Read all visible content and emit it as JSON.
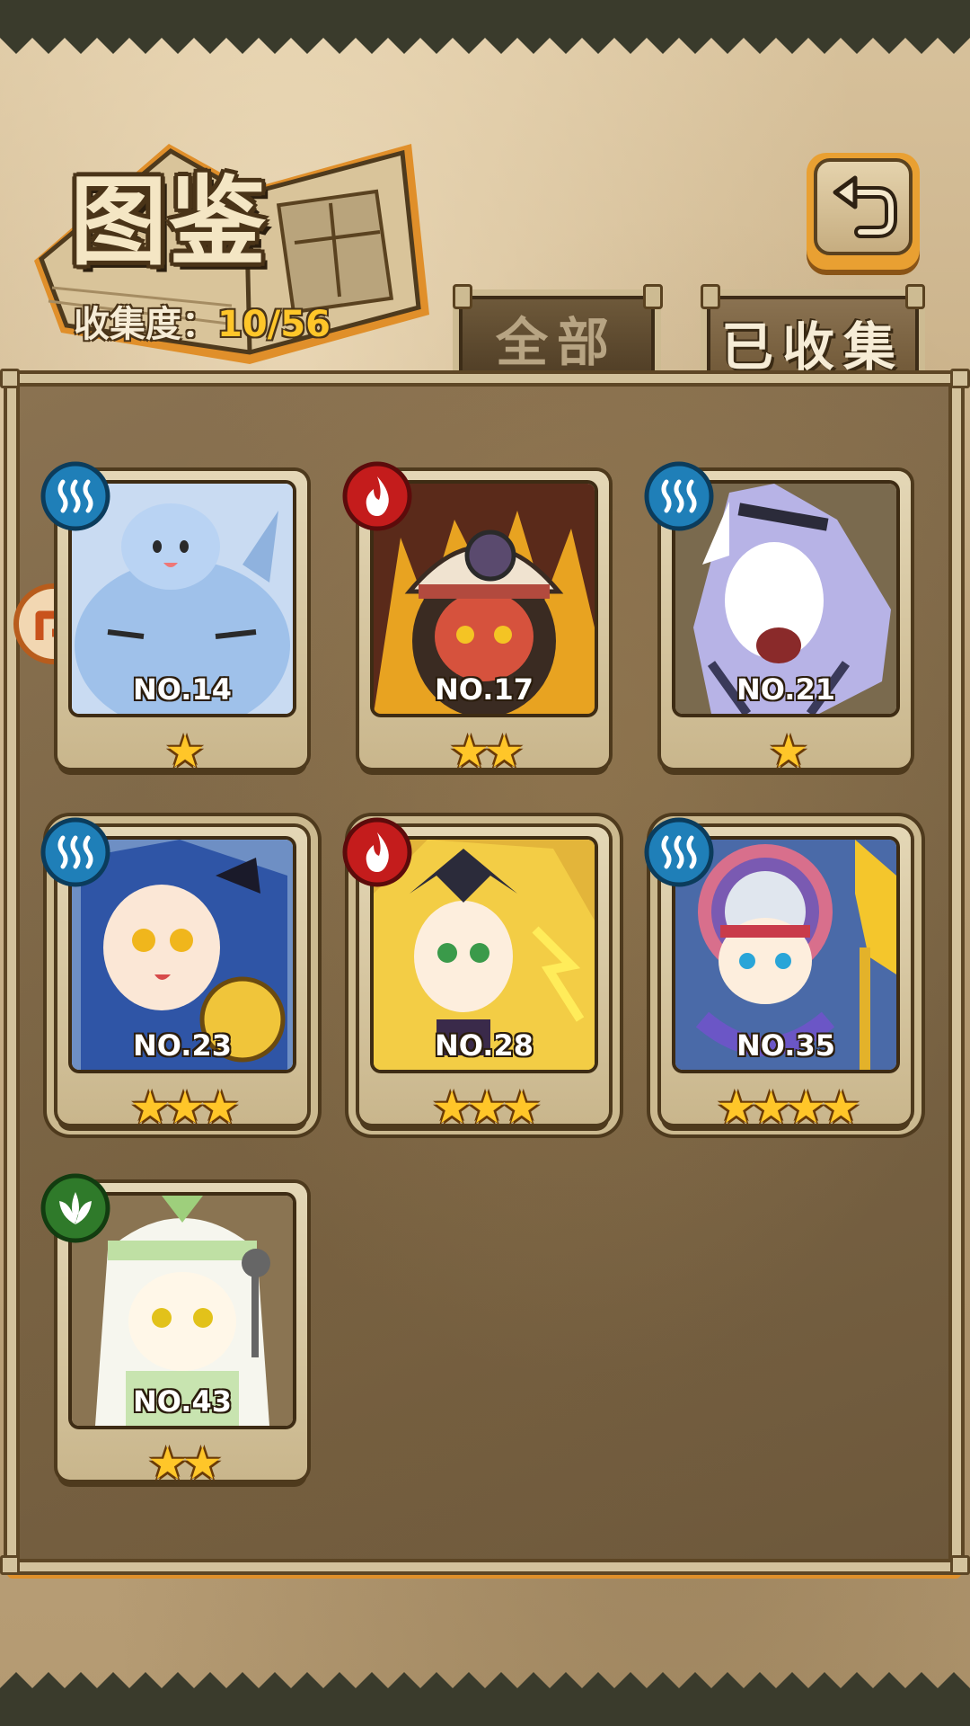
{
  "header": {
    "title": "图鉴",
    "collection_label": "收集度：",
    "collection_value": "10/56"
  },
  "tabs": [
    {
      "label": "全部",
      "active": false
    },
    {
      "label": "已收集",
      "active": true
    }
  ],
  "colors": {
    "water": "#1f7fb8",
    "fire": "#c41c1c",
    "nature": "#2f7a2a",
    "star": "#ffc629",
    "accent": "#e0902a"
  },
  "cards": [
    {
      "number": "NO.14",
      "stars": "★",
      "element": "water-icon"
    },
    {
      "number": "NO.17",
      "stars": "★★",
      "element": "fire-icon"
    },
    {
      "number": "NO.21",
      "stars": "★",
      "element": "water-icon"
    },
    {
      "number": "NO.23",
      "stars": "★★★",
      "element": "water-icon"
    },
    {
      "number": "NO.28",
      "stars": "★★★",
      "element": "fire-icon"
    },
    {
      "number": "NO.35",
      "stars": "★★★★",
      "element": "water-icon"
    },
    {
      "number": "NO.43",
      "stars": "★★",
      "element": "leaf-icon"
    }
  ]
}
